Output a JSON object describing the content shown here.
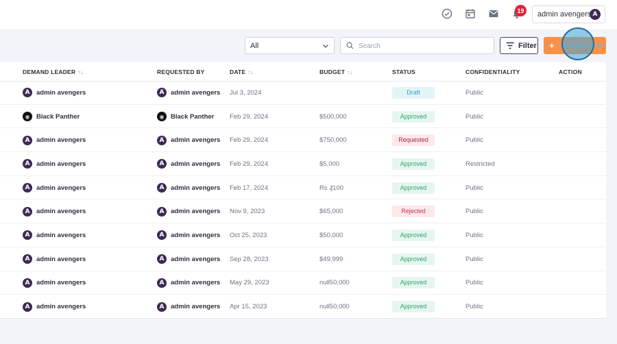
{
  "header": {
    "notification_count": "19",
    "user_name": "admin avengers",
    "icons": [
      "check-circle-icon",
      "calendar-icon",
      "mail-icon",
      "bell-icon"
    ]
  },
  "toolbar": {
    "select_value": "All",
    "search_placeholder": "Search",
    "filter_label": "Filter",
    "add_label": "Add Demand",
    "add_icon": "+"
  },
  "table": {
    "columns": {
      "demand_leader": "DEMAND LEADER",
      "requested_by": "REQUESTED BY",
      "date": "DATE",
      "budget": "BUDGET",
      "status": "STATUS",
      "confidentiality": "CONFIDENTIALITY",
      "action": "ACTION"
    },
    "sort_glyph": "↑↓",
    "rows": [
      {
        "leader": "admin avengers",
        "leader_avatar": "avenger",
        "requested_by": "admin avengers",
        "requested_avatar": "avenger",
        "date": "Jul 3, 2024",
        "budget": "",
        "status": "Draft",
        "status_kind": "draft",
        "confidentiality": "Public"
      },
      {
        "leader": "Black Panther",
        "leader_avatar": "panther",
        "requested_by": "Black Panther",
        "requested_avatar": "panther",
        "date": "Feb 29, 2024",
        "budget": "$500,000",
        "status": "Approved",
        "status_kind": "approved",
        "confidentiality": "Public"
      },
      {
        "leader": "admin avengers",
        "leader_avatar": "avenger",
        "requested_by": "admin avengers",
        "requested_avatar": "avenger",
        "date": "Feb 29, 2024",
        "budget": "$750,000",
        "status": "Requested",
        "status_kind": "requested",
        "confidentiality": "Public"
      },
      {
        "leader": "admin avengers",
        "leader_avatar": "avenger",
        "requested_by": "admin avengers",
        "requested_avatar": "avenger",
        "date": "Feb 29, 2024",
        "budget": "$5,000",
        "status": "Approved",
        "status_kind": "approved",
        "confidentiality": "Restricted"
      },
      {
        "leader": "admin avengers",
        "leader_avatar": "avenger",
        "requested_by": "admin avengers",
        "requested_avatar": "avenger",
        "date": "Feb 17, 2024",
        "budget": "Rs ₰100",
        "status": "Approved",
        "status_kind": "approved",
        "confidentiality": "Public"
      },
      {
        "leader": "admin avengers",
        "leader_avatar": "avenger",
        "requested_by": "admin avengers",
        "requested_avatar": "avenger",
        "date": "Nov 9, 2023",
        "budget": "$65,000",
        "status": "Rejected",
        "status_kind": "rejected",
        "confidentiality": "Public"
      },
      {
        "leader": "admin avengers",
        "leader_avatar": "avenger",
        "requested_by": "admin avengers",
        "requested_avatar": "avenger",
        "date": "Oct 25, 2023",
        "budget": "$50,000",
        "status": "Approved",
        "status_kind": "approved",
        "confidentiality": "Public"
      },
      {
        "leader": "admin avengers",
        "leader_avatar": "avenger",
        "requested_by": "admin avengers",
        "requested_avatar": "avenger",
        "date": "Sep 28, 2023",
        "budget": "$49,999",
        "status": "Approved",
        "status_kind": "approved",
        "confidentiality": "Public"
      },
      {
        "leader": "admin avengers",
        "leader_avatar": "avenger",
        "requested_by": "admin avengers",
        "requested_avatar": "avenger",
        "date": "May 29, 2023",
        "budget": "null50,000",
        "status": "Approved",
        "status_kind": "approved",
        "confidentiality": "Public"
      },
      {
        "leader": "admin avengers",
        "leader_avatar": "avenger",
        "requested_by": "admin avengers",
        "requested_avatar": "avenger",
        "date": "Apr 15, 2023",
        "budget": "null50,000",
        "status": "Approved",
        "status_kind": "approved",
        "confidentiality": "Public"
      }
    ]
  },
  "colors": {
    "accent": "#f5914a",
    "badge": "#e5213b",
    "status": {
      "draft": {
        "bg": "#e3f4f7",
        "fg": "#2aa7b8"
      },
      "approved": {
        "bg": "#e6f6ee",
        "fg": "#2ea56c"
      },
      "requested": {
        "bg": "#fde8ec",
        "fg": "#b3243e"
      },
      "rejected": {
        "bg": "#fde8ec",
        "fg": "#c2334c"
      }
    }
  }
}
